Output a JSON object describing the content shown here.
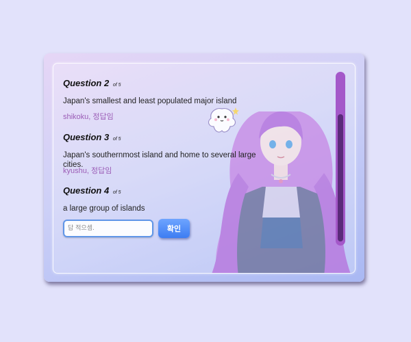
{
  "questions": [
    {
      "title": "Question 2",
      "of": "of 5",
      "text": "Japan's smallest and least populated major island",
      "answer": "shikoku, 정답임"
    },
    {
      "title": "Question 3",
      "of": "of 5",
      "text": "Japan's southernmost island and home to several large cities.",
      "answer": "kyushu, 정답임"
    },
    {
      "title": "Question 4",
      "of": "of 5",
      "text": "a large group of islands"
    }
  ],
  "answer_input": {
    "placeholder": "답 적으셈.",
    "value": ""
  },
  "confirm_button": {
    "label": "확인"
  },
  "colors": {
    "answer_text": "#9b5cb6",
    "button": "#3d7df2",
    "scrollbar_track": "#a458c9",
    "scrollbar_thumb": "#5a2a7a"
  },
  "icons": {
    "ghost": "ghost-mascot-icon",
    "character": "anime-girl-illustration"
  }
}
